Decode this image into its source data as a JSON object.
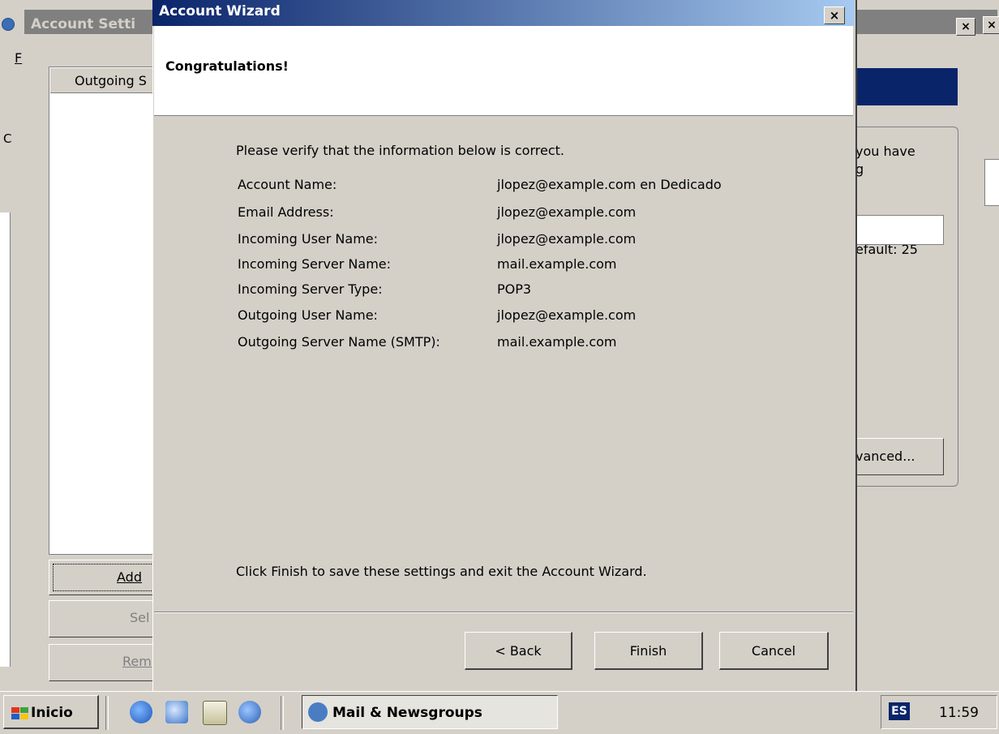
{
  "background_window": {
    "title": "Account Setti",
    "menu_f": "F",
    "list_header": "Outgoing S",
    "left_letter": "C",
    "buttons": {
      "add": "Add",
      "set": "Sel",
      "remove": "Rem"
    },
    "right_text_lines": [
      "you have",
      "g"
    ],
    "right_default": "efault:  25",
    "advanced_label": "vanced..."
  },
  "dialog": {
    "title": "Account Wizard",
    "heading": "Congratulations!",
    "verify_text": "Please verify that the information below is correct.",
    "fields": [
      {
        "label": "Account Name:",
        "value": "jlopez@example.com en Dedicado"
      },
      {
        "label": "Email Address:",
        "value": "jlopez@example.com"
      },
      {
        "label": "Incoming User Name:",
        "value": "jlopez@example.com"
      },
      {
        "label": "Incoming Server Name:",
        "value": "mail.example.com"
      },
      {
        "label": "Incoming Server Type:",
        "value": "POP3"
      },
      {
        "label": "Outgoing User Name:",
        "value": "jlopez@example.com"
      },
      {
        "label": "Outgoing Server Name (SMTP):",
        "value": "mail.example.com"
      }
    ],
    "finish_text": "Click Finish to save these settings and exit the Account Wizard.",
    "buttons": {
      "back": "< Back",
      "finish": "Finish",
      "cancel": "Cancel"
    }
  },
  "taskbar": {
    "start_label": "Inicio",
    "task_label": "Mail & Newsgroups",
    "language": "ES",
    "clock": "11:59"
  },
  "colors": {
    "title_active": "#0a246a",
    "face": "#d4d0c8",
    "shadow": "#808080"
  }
}
